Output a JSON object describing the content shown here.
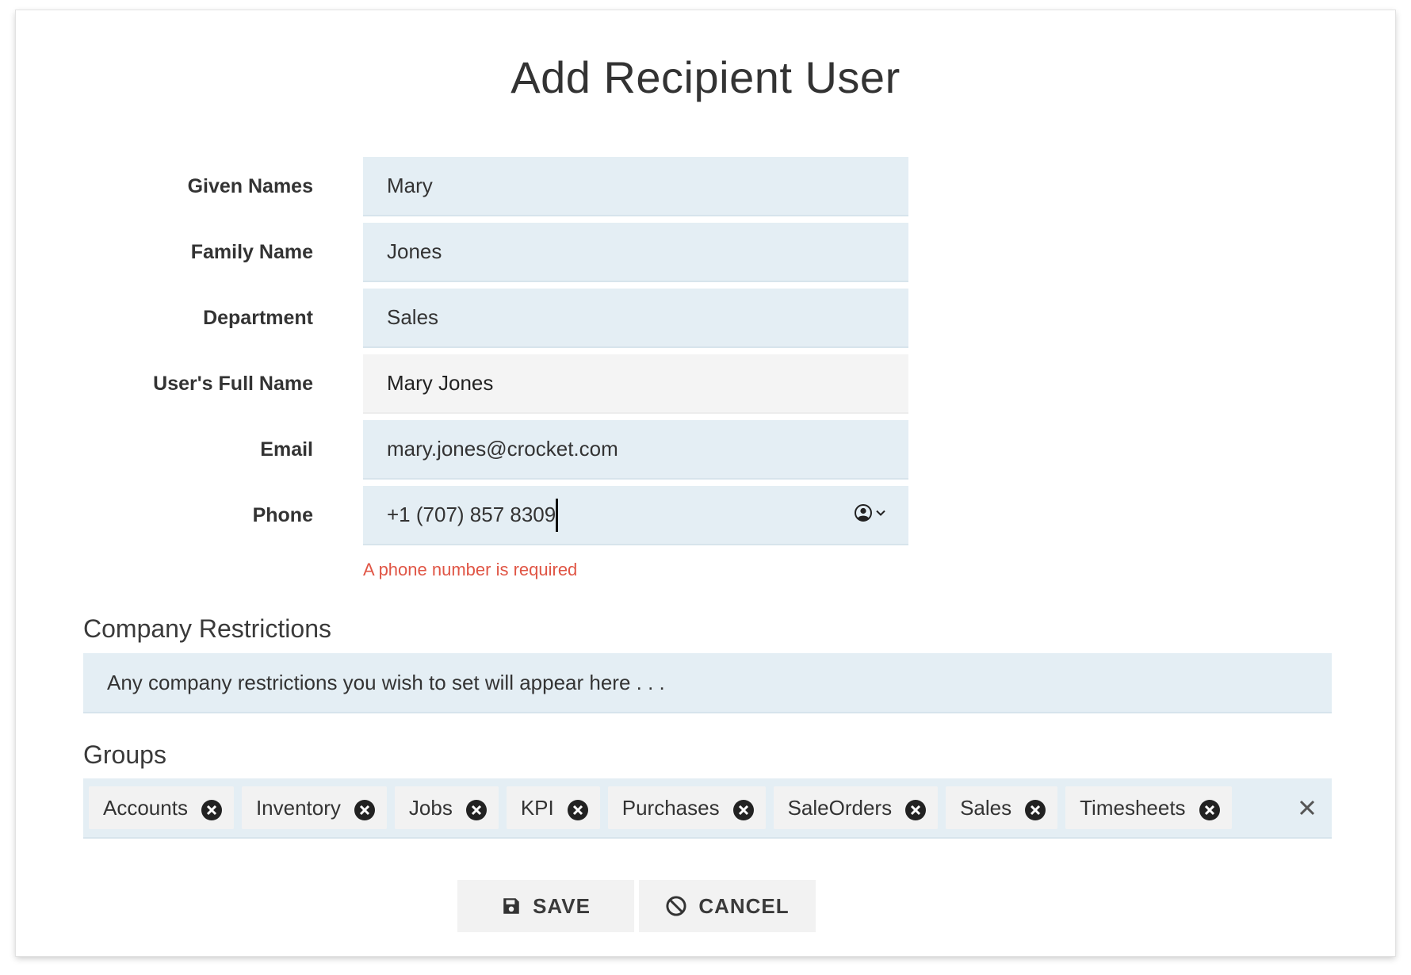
{
  "dialog": {
    "title": "Add Recipient User"
  },
  "form": {
    "given_names": {
      "label": "Given Names",
      "value": "Mary"
    },
    "family_name": {
      "label": "Family Name",
      "value": "Jones"
    },
    "department": {
      "label": "Department",
      "value": "Sales"
    },
    "full_name": {
      "label": "User's Full Name",
      "value": "Mary Jones"
    },
    "email": {
      "label": "Email",
      "value": "mary.jones@crocket.com"
    },
    "phone": {
      "label": "Phone",
      "value": "+1 (707) 857 8309",
      "error": "A phone number is required",
      "contact_icon": "user-circle-icon"
    }
  },
  "company_restrictions": {
    "heading": "Company Restrictions",
    "placeholder": "Any company restrictions you wish to set will appear here . . ."
  },
  "groups": {
    "heading": "Groups",
    "chips": [
      "Accounts",
      "Inventory",
      "Jobs",
      "KPI",
      "Purchases",
      "SaleOrders",
      "Sales",
      "Timesheets"
    ]
  },
  "buttons": {
    "save": {
      "label": "SAVE",
      "icon": "floppy-disk-icon"
    },
    "cancel": {
      "label": "CANCEL",
      "icon": "cancel-circle-icon"
    }
  },
  "colors": {
    "field_bg": "#e4eef4",
    "readonly_bg": "#f4f4f4",
    "error": "#e05545",
    "chip_bg": "#f2f2f2",
    "button_bg": "#f2f2f2"
  }
}
